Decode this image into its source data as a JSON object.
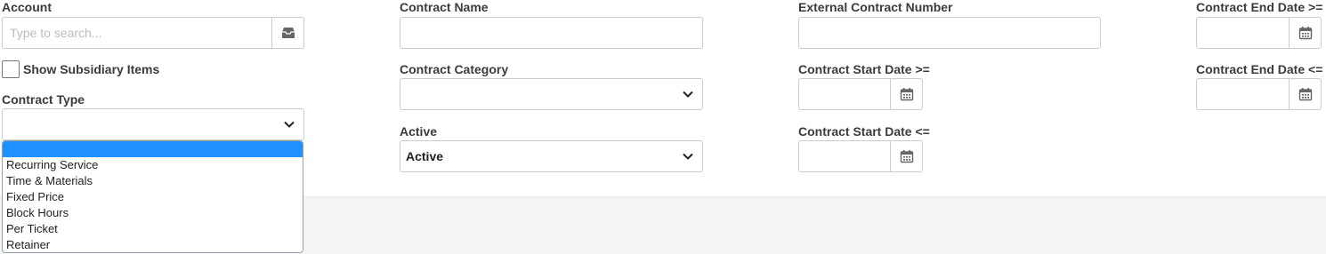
{
  "filters": {
    "account": {
      "label": "Account",
      "placeholder": "Type to search..."
    },
    "show_subsidiary": {
      "label": "Show Subsidiary Items",
      "checked": false
    },
    "contract_type": {
      "label": "Contract Type",
      "options": [
        "",
        "Recurring Service",
        "Time & Materials",
        "Fixed Price",
        "Block Hours",
        "Per Ticket",
        "Retainer"
      ]
    },
    "contract_name": {
      "label": "Contract Name",
      "value": ""
    },
    "contract_category": {
      "label": "Contract Category",
      "value": ""
    },
    "active": {
      "label": "Active",
      "value": "Active"
    },
    "external_contract_number": {
      "label": "External Contract Number",
      "value": ""
    },
    "contract_start_date_gte": {
      "label": "Contract Start Date >=",
      "value": ""
    },
    "contract_start_date_lte": {
      "label": "Contract Start Date <=",
      "value": ""
    },
    "contract_end_date_gte": {
      "label": "Contract End Date >=",
      "value": ""
    },
    "contract_end_date_lte": {
      "label": "Contract End Date <=",
      "value": ""
    }
  },
  "icons": {
    "account_lookup": "tray-icon",
    "calendar": "calendar-icon",
    "chevron": "chevron-down-icon"
  },
  "colors": {
    "dropdown_selected": "#1e90ff",
    "footer_band": "#f3f4f6"
  }
}
